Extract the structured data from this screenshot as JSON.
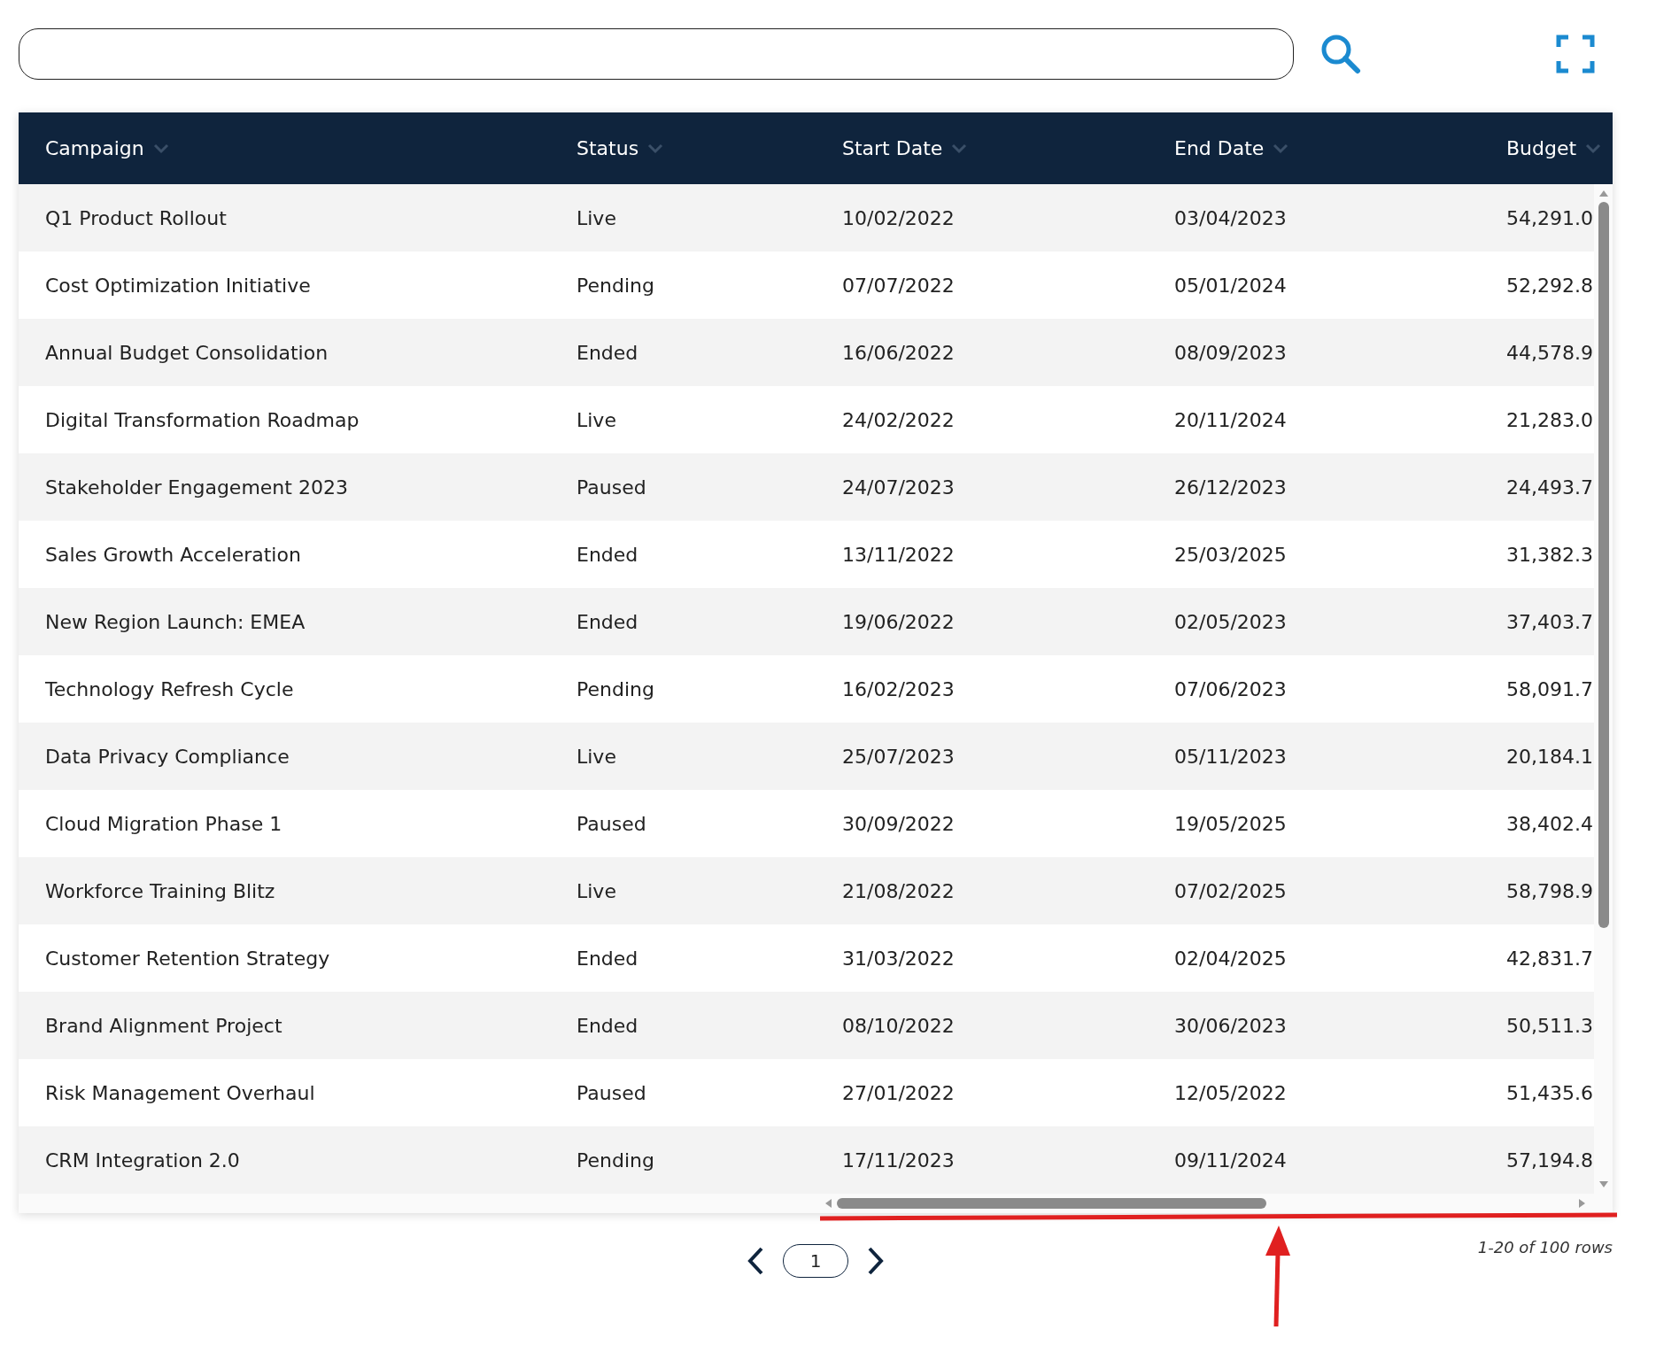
{
  "columns": [
    "Campaign",
    "Status",
    "Start Date",
    "End Date",
    "Budget"
  ],
  "rows": [
    [
      "Q1 Product Rollout",
      "Live",
      "10/02/2022",
      "03/04/2023",
      "54,291.0"
    ],
    [
      "Cost Optimization Initiative",
      "Pending",
      "07/07/2022",
      "05/01/2024",
      "52,292.8"
    ],
    [
      "Annual Budget Consolidation",
      "Ended",
      "16/06/2022",
      "08/09/2023",
      "44,578.9"
    ],
    [
      "Digital Transformation Roadmap",
      "Live",
      "24/02/2022",
      "20/11/2024",
      "21,283.0"
    ],
    [
      "Stakeholder Engagement 2023",
      "Paused",
      "24/07/2023",
      "26/12/2023",
      "24,493.7"
    ],
    [
      "Sales Growth Acceleration",
      "Ended",
      "13/11/2022",
      "25/03/2025",
      "31,382.3"
    ],
    [
      "New Region Launch: EMEA",
      "Ended",
      "19/06/2022",
      "02/05/2023",
      "37,403.7"
    ],
    [
      "Technology Refresh Cycle",
      "Pending",
      "16/02/2023",
      "07/06/2023",
      "58,091.7"
    ],
    [
      "Data Privacy Compliance",
      "Live",
      "25/07/2023",
      "05/11/2023",
      "20,184.1"
    ],
    [
      "Cloud Migration Phase 1",
      "Paused",
      "30/09/2022",
      "19/05/2025",
      "38,402.4"
    ],
    [
      "Workforce Training Blitz",
      "Live",
      "21/08/2022",
      "07/02/2025",
      "58,798.9"
    ],
    [
      "Customer Retention Strategy",
      "Ended",
      "31/03/2022",
      "02/04/2025",
      "42,831.7"
    ],
    [
      "Brand Alignment Project",
      "Ended",
      "08/10/2022",
      "30/06/2023",
      "50,511.3"
    ],
    [
      "Risk Management Overhaul",
      "Paused",
      "27/01/2022",
      "12/05/2022",
      "51,435.6"
    ],
    [
      "CRM Integration 2.0",
      "Pending",
      "17/11/2023",
      "09/11/2024",
      "57,194.8"
    ]
  ],
  "pagination": {
    "page": "1",
    "summary": "1-20 of 100 rows"
  }
}
